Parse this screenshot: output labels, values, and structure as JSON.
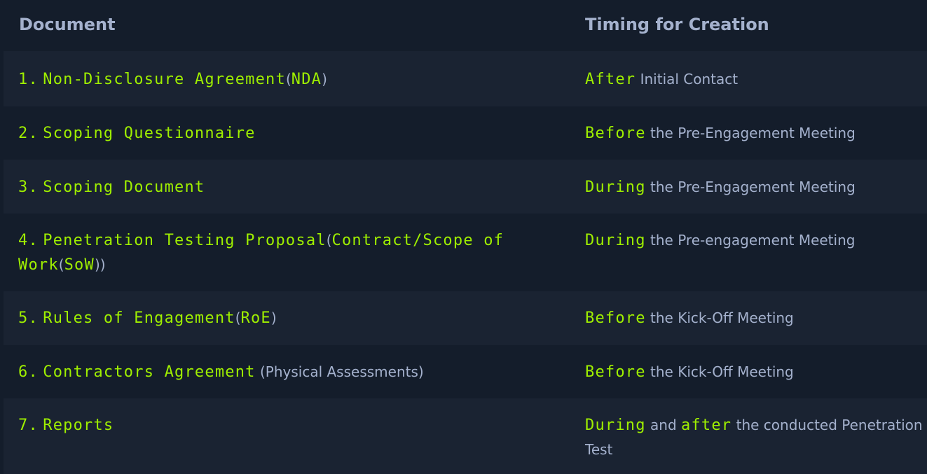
{
  "table": {
    "headers": {
      "document": "Document",
      "timing": "Timing for Creation"
    },
    "rows": [
      {
        "doc_num": "1.",
        "doc_name": "Non-Disclosure Agreement",
        "doc_open": "(",
        "doc_abbr": "NDA",
        "doc_close": ")",
        "timing_keyword": "After",
        "timing_text": "Initial Contact"
      },
      {
        "doc_num": "2.",
        "doc_name": "Scoping Questionnaire",
        "timing_keyword": "Before",
        "timing_text": "the Pre-Engagement Meeting"
      },
      {
        "doc_num": "3.",
        "doc_name": "Scoping Document",
        "timing_keyword": "During",
        "timing_text": "the Pre-Engagement Meeting"
      },
      {
        "doc_num": "4.",
        "doc_name": "Penetration Testing Proposal",
        "doc_open": "(",
        "doc_abbr": "Contract/Scope of Work",
        "doc_open2": "(",
        "doc_abbr2": "SoW",
        "doc_close": "))",
        "timing_keyword": "During",
        "timing_text": "the Pre-engagement Meeting"
      },
      {
        "doc_num": "5.",
        "doc_name": "Rules of Engagement",
        "doc_open": "(",
        "doc_abbr": "RoE",
        "doc_close": ")",
        "timing_keyword": "Before",
        "timing_text": "the Kick-Off Meeting"
      },
      {
        "doc_num": "6.",
        "doc_name": "Contractors Agreement",
        "doc_note": "(Physical Assessments)",
        "timing_keyword": "Before",
        "timing_text": "the Kick-Off Meeting"
      },
      {
        "doc_num": "7.",
        "doc_name": "Reports",
        "timing_keyword": "During",
        "timing_and": "and",
        "timing_keyword2": "after",
        "timing_text": "the conducted Penetration Test"
      }
    ]
  },
  "colors": {
    "background": "#141d2b",
    "stripe": "#1a2332",
    "accent_green": "#9fef00",
    "text": "#a4b1cd"
  }
}
